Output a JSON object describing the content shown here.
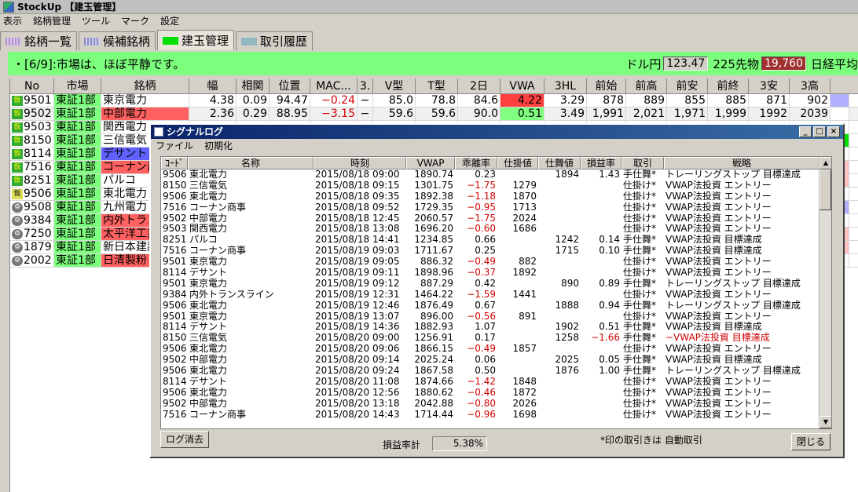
{
  "app": {
    "title": "StockUp 【建玉管理】"
  },
  "menu": [
    "表示",
    "銘柄管理",
    "ツール",
    "マーク",
    "設定"
  ],
  "tabs": [
    {
      "label": "銘柄一覧",
      "color": "#b090d0",
      "active": false
    },
    {
      "label": "候補銘柄",
      "color": "#9090c8",
      "active": false
    },
    {
      "label": "建玉管理",
      "color": "#00e000",
      "active": true
    },
    {
      "label": "取引履歴",
      "color": "#90b8c0",
      "active": false
    }
  ],
  "status": {
    "message": "・[6/9]:市場は、ほぼ平静です。",
    "usdjpy_label": "ドル円",
    "usdjpy_value": "123.47",
    "futures_label": "225先物",
    "futures_value": "19,760",
    "nikkei_label": "日経平均"
  },
  "grid": {
    "headers": [
      "No",
      "市場",
      "銘柄",
      "幅",
      "相関",
      "位置",
      "MAC...",
      "3.",
      "V型",
      "T型",
      "2日",
      "VWA",
      "3HL",
      "前始",
      "前高",
      "前安",
      "前終",
      "3安",
      "3高"
    ],
    "rows": [
      {
        "tag": "仮",
        "no": "9501",
        "market": "東証1部",
        "name": "東京電力",
        "haba": "4.38",
        "soukan": "0.09",
        "ichi": "94.47",
        "mac": "−0.24",
        "three": "−",
        "v": "85.0",
        "t": "78.8",
        "d2": "84.6",
        "vwa": "4.22",
        "hl3": "3.29",
        "maeshi": "878",
        "maetaka": "889",
        "maeyasu": "855",
        "maeowari": "885",
        "yasu3": "871",
        "taka3": "902"
      },
      {
        "tag": "仮",
        "no": "9502",
        "market": "東証1部",
        "name": "中部電力",
        "haba": "2.36",
        "soukan": "0.29",
        "ichi": "88.95",
        "mac": "−3.15",
        "three": "−",
        "v": "59.6",
        "t": "59.6",
        "d2": "90.0",
        "vwa": "0.51",
        "hl3": "3.49",
        "maeshi": "1,991",
        "maetaka": "2,021",
        "maeyasu": "1,971",
        "maeowari": "1,999",
        "yasu3": "1992",
        "taka3": "2039"
      },
      {
        "tag": "仮",
        "no": "9503",
        "market": "東証1部",
        "name": "関西電力"
      },
      {
        "tag": "仮",
        "no": "8150",
        "market": "東証1部",
        "name": "三信電気"
      },
      {
        "tag": "仮",
        "no": "8114",
        "market": "東証1部",
        "name": "デサント"
      },
      {
        "tag": "仮",
        "no": "7516",
        "market": "東証1部",
        "name": "コーナン商事"
      },
      {
        "tag": "仮",
        "no": "8251",
        "market": "東証1部",
        "name": "パルコ"
      },
      {
        "tag": "仮",
        "no": "9506",
        "market": "東証1部",
        "name": "東北電力"
      },
      {
        "tag": "⚙",
        "no": "9508",
        "market": "東証1部",
        "name": "九州電力"
      },
      {
        "tag": "⚙",
        "no": "9384",
        "market": "東証1部",
        "name": "内外トランスライン"
      },
      {
        "tag": "⚙",
        "no": "7250",
        "market": "東証1部",
        "name": "太平洋工業"
      },
      {
        "tag": "⚙",
        "no": "1879",
        "market": "東証1部",
        "name": "新日本建設"
      },
      {
        "tag": "⚙",
        "no": "2002",
        "market": "東証1部",
        "name": "日清製粉"
      }
    ]
  },
  "dialog": {
    "title": "シグナルログ",
    "menu": [
      "ファイル",
      "初期化"
    ],
    "headers": [
      "ｺｰﾄﾞ",
      "名称",
      "時刻",
      "VWAP",
      "乖離率",
      "仕掛値",
      "仕舞値",
      "損益率",
      "取引",
      "戦略"
    ],
    "rows": [
      [
        "9506",
        "東北電力",
        "2015/08/18 09:00",
        "1890.74",
        "0.23",
        "",
        "1894",
        "1.43",
        "手仕舞*",
        "トレーリングストップ 目標達成"
      ],
      [
        "8150",
        "三信電気",
        "2015/08/18 09:15",
        "1301.75",
        "−1.75",
        "1279",
        "",
        "",
        "仕掛け*",
        "VWAP法投資 エントリー"
      ],
      [
        "9506",
        "東北電力",
        "2015/08/18 09:35",
        "1892.38",
        "−1.18",
        "1870",
        "",
        "",
        "仕掛け*",
        "VWAP法投資 エントリー"
      ],
      [
        "7516",
        "コーナン商事",
        "2015/08/18 09:52",
        "1729.35",
        "−0.95",
        "1713",
        "",
        "",
        "仕掛け*",
        "VWAP法投資 エントリー"
      ],
      [
        "9502",
        "中部電力",
        "2015/08/18 12:45",
        "2060.57",
        "−1.75",
        "2024",
        "",
        "",
        "仕掛け*",
        "VWAP法投資 エントリー"
      ],
      [
        "9503",
        "関西電力",
        "2015/08/18 13:08",
        "1696.20",
        "−0.60",
        "1686",
        "",
        "",
        "仕掛け*",
        "VWAP法投資 エントリー"
      ],
      [
        "8251",
        "パルコ",
        "2015/08/18 14:41",
        "1234.85",
        "0.66",
        "",
        "1242",
        "0.14",
        "手仕舞*",
        "VWAP法投資 目標達成"
      ],
      [
        "7516",
        "コーナン商事",
        "2015/08/19 09:03",
        "1711.67",
        "0.25",
        "",
        "1715",
        "0.10",
        "手仕舞*",
        "VWAP法投資 目標達成"
      ],
      [
        "9501",
        "東京電力",
        "2015/08/19 09:05",
        "886.32",
        "−0.49",
        "882",
        "",
        "",
        "仕掛け*",
        "VWAP法投資 エントリー"
      ],
      [
        "8114",
        "デサント",
        "2015/08/19 09:11",
        "1898.96",
        "−0.37",
        "1892",
        "",
        "",
        "仕掛け*",
        "VWAP法投資 エントリー"
      ],
      [
        "9501",
        "東京電力",
        "2015/08/19 09:12",
        "887.29",
        "0.42",
        "",
        "890",
        "0.89",
        "手仕舞*",
        "トレーリングストップ 目標達成"
      ],
      [
        "9384",
        "内外トランスライン",
        "2015/08/19 12:31",
        "1464.22",
        "−1.59",
        "1441",
        "",
        "",
        "仕掛け*",
        "VWAP法投資 エントリー"
      ],
      [
        "9506",
        "東北電力",
        "2015/08/19 12:46",
        "1876.49",
        "0.67",
        "",
        "1888",
        "0.94",
        "手仕舞*",
        "トレーリングストップ 目標達成"
      ],
      [
        "9501",
        "東京電力",
        "2015/08/19 13:07",
        "896.00",
        "−0.56",
        "891",
        "",
        "",
        "仕掛け*",
        "VWAP法投資 エントリー"
      ],
      [
        "8114",
        "デサント",
        "2015/08/19 14:36",
        "1882.93",
        "1.07",
        "",
        "1902",
        "0.51",
        "手仕舞*",
        "VWAP法投資 目標達成"
      ],
      [
        "8150",
        "三信電気",
        "2015/08/20 09:00",
        "1256.91",
        "0.17",
        "",
        "1258",
        "−1.66",
        "手仕舞*",
        "−VWAP法投資 目標達成"
      ],
      [
        "9506",
        "東北電力",
        "2015/08/20 09:06",
        "1866.15",
        "−0.49",
        "1857",
        "",
        "",
        "仕掛け*",
        "VWAP法投資 エントリー"
      ],
      [
        "9502",
        "中部電力",
        "2015/08/20 09:14",
        "2025.24",
        "0.06",
        "",
        "2025",
        "0.05",
        "手仕舞*",
        "VWAP法投資 目標達成"
      ],
      [
        "9506",
        "東北電力",
        "2015/08/20 09:24",
        "1867.58",
        "0.50",
        "",
        "1876",
        "1.00",
        "手仕舞*",
        "トレーリングストップ 目標達成"
      ],
      [
        "8114",
        "デサント",
        "2015/08/20 11:08",
        "1874.66",
        "−1.42",
        "1848",
        "",
        "",
        "仕掛け*",
        "VWAP法投資 エントリー"
      ],
      [
        "9506",
        "東北電力",
        "2015/08/20 12:56",
        "1880.62",
        "−0.46",
        "1872",
        "",
        "",
        "仕掛け*",
        "VWAP法投資 エントリー"
      ],
      [
        "9502",
        "中部電力",
        "2015/08/20 13:18",
        "2042.88",
        "−0.80",
        "2026",
        "",
        "",
        "仕掛け*",
        "VWAP法投資 エントリー"
      ],
      [
        "7516",
        "コーナン商事",
        "2015/08/20 14:43",
        "1714.44",
        "−0.96",
        "1698",
        "",
        "",
        "仕掛け*",
        "VWAP法投資 エントリー"
      ]
    ],
    "clear_label": "ログ消去",
    "pl_label": "損益率計",
    "pl_value": "5.38%",
    "note": "*印の取引きは 自動取引",
    "close_label": "閉じる"
  }
}
